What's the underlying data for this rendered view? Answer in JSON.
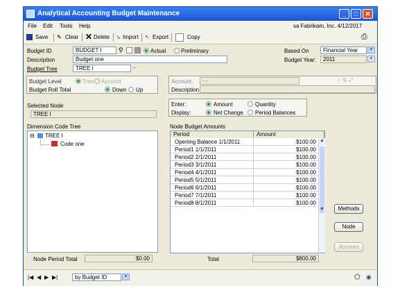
{
  "window": {
    "title": "Analytical Accounting Budget Maintenance"
  },
  "menu": {
    "items": [
      "File",
      "Edit",
      "Tools",
      "Help"
    ],
    "company": "sa  Fabrikam, Inc.  4/12/2017"
  },
  "toolbar": {
    "save": "Save",
    "clear": "Clear",
    "delete": "Delete",
    "import": "Import",
    "export": "Export",
    "copy": "Copy"
  },
  "budget": {
    "id_label": "Budget ID",
    "id_value": "BUDGET I",
    "actual": "Actual",
    "preliminary": "Preliminary",
    "desc_label": "Description",
    "desc_value": "Budget one",
    "tree_label": "Budget Tree",
    "tree_value": "TREE I",
    "based_on_label": "Based On",
    "based_on_value": "Financial Year",
    "year_label": "Budget Year:",
    "year_value": "2011"
  },
  "level": {
    "label": "Budget Level",
    "tree": "Tree",
    "account": "Account",
    "rollup_label": "Budget Roll Total",
    "down": "Down",
    "up": "Up"
  },
  "account": {
    "label": "Account:",
    "value": "-   -",
    "desc_label": "Description"
  },
  "entry": {
    "enter_label": "Enter:",
    "amount": "Amount",
    "quantity": "Quantity",
    "display_label": "Display:",
    "net_change": "Net Change",
    "period_balances": "Period Balances"
  },
  "selected_node": {
    "label": "Selected Node",
    "value": "TREE I"
  },
  "dimension_tree": {
    "label": "Dimension Code Tree",
    "root": "TREE I",
    "child": "Code one"
  },
  "node_period_total": {
    "label": "Node Period Total",
    "value": "$0.00"
  },
  "node_budget": {
    "label": "Node Budget Amounts",
    "headers": [
      "Period",
      "Amount"
    ],
    "rows": [
      {
        "period": "Opening Balance 1/1/2011",
        "amount": "$100.00"
      },
      {
        "period": "Period1 1/1/2011",
        "amount": "$100.00"
      },
      {
        "period": "Period2 2/1/2011",
        "amount": "$100.00"
      },
      {
        "period": "Period3 3/1/2011",
        "amount": "$100.00"
      },
      {
        "period": "Period4 4/1/2011",
        "amount": "$100.00"
      },
      {
        "period": "Period5 5/1/2011",
        "amount": "$100.00"
      },
      {
        "period": "Period6 6/1/2011",
        "amount": "$100.00"
      },
      {
        "period": "Period7 7/1/2011",
        "amount": "$100.00"
      },
      {
        "period": "Period8 8/1/2011",
        "amount": "$100.00"
      }
    ],
    "total_label": "Total",
    "total_value": "$800.00"
  },
  "buttons": {
    "methods": "Methods",
    "node": "Node",
    "account": "Account"
  },
  "status": {
    "sort": "by Budget ID"
  }
}
